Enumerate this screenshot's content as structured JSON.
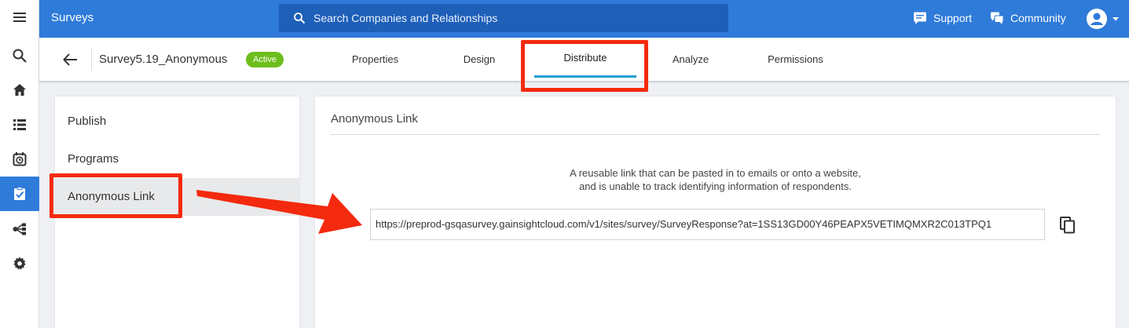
{
  "colors": {
    "brand": "#2f7bd9",
    "search_bg": "#1e5fb8",
    "active_badge": "#6dbe1c",
    "tab_underline": "#1b9fd1",
    "annotation": "#f42a0e"
  },
  "rail": {
    "items": [
      {
        "icon": "menu-icon"
      },
      {
        "icon": "search-icon"
      },
      {
        "icon": "home-icon"
      },
      {
        "icon": "list-icon"
      },
      {
        "icon": "calendar-clock-icon"
      },
      {
        "icon": "survey-clipboard-icon",
        "active": true
      },
      {
        "icon": "journey-flow-icon"
      },
      {
        "icon": "settings-gear-icon"
      }
    ]
  },
  "topbar": {
    "app_title": "Surveys",
    "search_placeholder": "Search Companies and Relationships",
    "support_label": "Support",
    "community_label": "Community"
  },
  "subheader": {
    "survey_name": "Survey5.19_Anonymous",
    "status_badge": "Active",
    "tabs": [
      {
        "label": "Properties"
      },
      {
        "label": "Design"
      },
      {
        "label": "Distribute",
        "active": true
      },
      {
        "label": "Analyze"
      },
      {
        "label": "Permissions"
      }
    ]
  },
  "sidebar": {
    "items": [
      {
        "label": "Publish"
      },
      {
        "label": "Programs"
      },
      {
        "label": "Anonymous Link",
        "selected": true
      }
    ]
  },
  "main": {
    "title": "Anonymous Link",
    "description_line1": "A reusable link that can be pasted in to emails or onto a website,",
    "description_line2": "and is unable to track identifying information of respondents.",
    "link_value": "https://preprod-gsqasurvey.gainsightcloud.com/v1/sites/survey/SurveyResponse?at=1SS13GD00Y46PEAPX5VETIMQMXR2C013TPQ1"
  }
}
